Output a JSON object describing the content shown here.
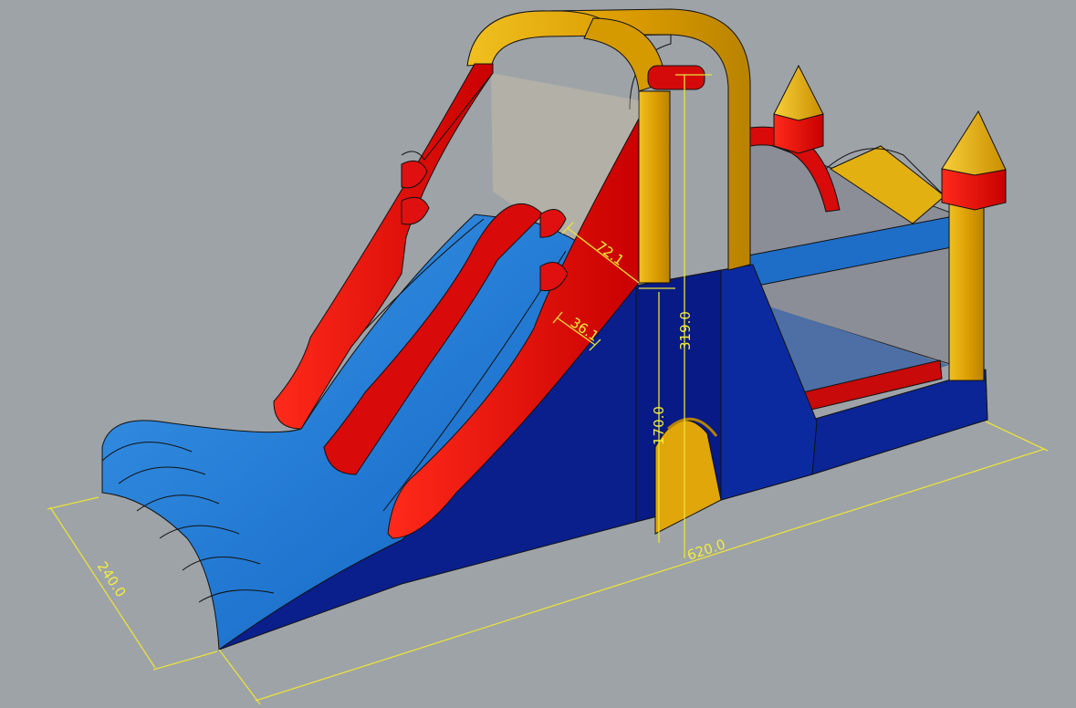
{
  "dimensions": [
    {
      "id": "depth",
      "label": "240.0"
    },
    {
      "id": "length",
      "label": "620.0"
    },
    {
      "id": "total_height",
      "label": "319.0"
    },
    {
      "id": "platform_height",
      "label": "170.0"
    },
    {
      "id": "slide_lane_width",
      "label": "72.1"
    },
    {
      "id": "side_wall_width",
      "label": "36.1"
    }
  ],
  "colors": {
    "background": "#9ea3a8",
    "base_blue": "#0a1f8c",
    "slide_blue": "#1b78d6",
    "red": "#e30a0a",
    "yellow": "#e8ad06",
    "dimension": "#e8e23a"
  }
}
